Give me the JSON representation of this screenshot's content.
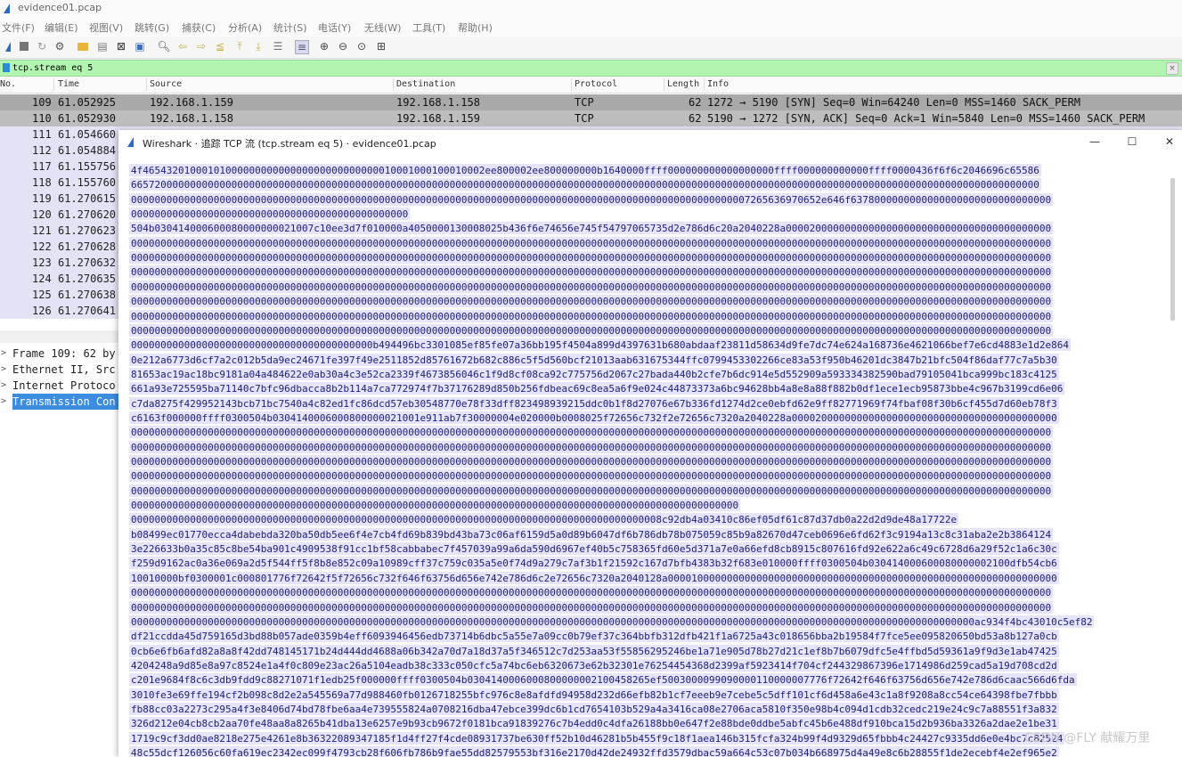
{
  "window": {
    "title": "evidence01.pcap"
  },
  "menu": [
    "文件(F)",
    "编辑(E)",
    "视图(V)",
    "跳转(G)",
    "捕获(C)",
    "分析(A)",
    "统计(S)",
    "电话(Y)",
    "无线(W)",
    "工具(T)",
    "帮助(H)"
  ],
  "toolbar_icons": [
    "shark-fin-start-icon",
    "stop-icon",
    "restart-icon",
    "capture-options-icon",
    "open-folder-icon",
    "save-icon",
    "close-file-icon",
    "reload-icon",
    "find-icon",
    "go-back-icon",
    "go-forward-icon",
    "go-to-packet-icon",
    "go-first-icon",
    "go-last-icon",
    "auto-scroll-icon",
    "colorize-icon",
    "zoom-in-icon",
    "zoom-out-icon",
    "zoom-reset-icon",
    "resize-columns-icon"
  ],
  "filter": {
    "value": "tcp.stream eq 5"
  },
  "packet_list": {
    "headers": {
      "no": "No.",
      "time": "Time",
      "source": "Source",
      "destination": "Destination",
      "protocol": "Protocol",
      "length": "Length",
      "info": "Info"
    },
    "rows": [
      {
        "no": "109",
        "time": "61.052925",
        "source": "192.168.1.159",
        "destination": "192.168.1.158",
        "protocol": "TCP",
        "length": "62",
        "info": "1272 → 5190 [SYN] Seq=0 Win=64240 Len=0 MSS=1460 SACK_PERM"
      },
      {
        "no": "110",
        "time": "61.052930",
        "source": "192.168.1.158",
        "destination": "192.168.1.159",
        "protocol": "TCP",
        "length": "62",
        "info": "5190 → 1272 [SYN, ACK] Seq=0 Ack=1 Win=5840 Len=0 MSS=1460 SACK_PERM"
      },
      {
        "no": "111",
        "time": "61.054660"
      },
      {
        "no": "112",
        "time": "61.054884"
      },
      {
        "no": "117",
        "time": "61.155756"
      },
      {
        "no": "118",
        "time": "61.155760"
      },
      {
        "no": "119",
        "time": "61.270615"
      },
      {
        "no": "120",
        "time": "61.270620"
      },
      {
        "no": "121",
        "time": "61.270623"
      },
      {
        "no": "122",
        "time": "61.270628"
      },
      {
        "no": "123",
        "time": "61.270632"
      },
      {
        "no": "124",
        "time": "61.270635"
      },
      {
        "no": "125",
        "time": "61.270638"
      },
      {
        "no": "126",
        "time": "61.270641"
      }
    ]
  },
  "details": [
    "Frame 109: 62 by",
    "Ethernet II, Src",
    "Internet Protoco",
    "Transmission Con"
  ],
  "dialog": {
    "title": "Wireshark · 追踪 TCP 流 (tcp.stream eq 5) · evidence01.pcap",
    "stream_lines": [
      "4f4654320100010100000000000000000000000000010001000100010002ee800002ee800000000b1640000ffff000000000000000000ffff000000000000ffff0000436f6f6c2046696c65586",
      "6657200000000000000000000000000000000000000000000000000000000000000000000000000000000000000000000000000000000000000000000000000000000000000000000000000000",
      "000000000000000000000000000000000000000000000000000000000000000000000000000000000000000000000000000000007265636970652e646f6378000000000000000000000000000000",
      "00000000000000000000000000000000000000000000000",
      "504b030414000600080000000021007c10ee3d7f010000a4050000130008025b436f6e74656e745f54797065735d2e786d6c20a2040228a000020000000000000000000000000000000000000000",
      "000000000000000000000000000000000000000000000000000000000000000000000000000000000000000000000000000000000000000000000000000000000000000000000000000000000000",
      "000000000000000000000000000000000000000000000000000000000000000000000000000000000000000000000000000000000000000000000000000000000000000000000000000000000000",
      "000000000000000000000000000000000000000000000000000000000000000000000000000000000000000000000000000000000000000000000000000000000000000000000000000000000000",
      "000000000000000000000000000000000000000000000000000000000000000000000000000000000000000000000000000000000000000000000000000000000000000000000000000000000000",
      "000000000000000000000000000000000000000000000000000000000000000000000000000000000000000000000000000000000000000000000000000000000000000000000000000000000000",
      "000000000000000000000000000000000000000000000000000000000000000000000000000000000000000000000000000000000000000000000000000000000000000000000000000000000000",
      "000000000000000000000000000000000000000000000000000000000000000000000000000000000000000000000000000000000000000000000000000000000000000000000000000000000000",
      "00000000000000000000000000000000000000000b494496bc3301085ef85fe07a36bb195f4504a899d4397631b680abdaaf23811d58634d9fe7dc74e624a168736e4621066bef7e6cd4883e1d2e864",
      "0e212a6773d6cf7a2c012b5da9ec24671fe397f49e2511852d85761672b682c886c5f5d560bcf21013aab631675344ffc0799453302266ce83a53f950b46201dc3847b21bfc504f86daf77c7a5b30",
      "81653ac19ac18bc9181a04a484622e0ab30a4c3e52ca2339f4673856046c1f9d8cf08ca92c775756d2067c27bada440b2cfe7b6dc914e5d552909a593334382590bad79105041bca999bc183c4125",
      "661a93e725595ba71140c7bfc96dbacca8b2b114a7ca772974f7b37176289d850b256fdbeac69c8ea5a6f9e024c44873373a6bc94628bb4a8e8a88f882b0df1ece1ecb95873bbe4c967b3199cd6e06",
      "c7da8275f429952143bcb71bc7540a4c82ed1fc86dcd57eb30548770e78f33dff823498939215ddc0b1f8d27076e67b336fd1274d2ce0ebfd62e9ff82771969f74fbaf08f30b6cf455d7d60eb78f3",
      "c6163f000000ffff0300504b0304140006000800000021001e911ab7f30000004e020000b0008025f72656c732f2e72656c7320a2040228a000020000000000000000000000000000000000000000",
      "000000000000000000000000000000000000000000000000000000000000000000000000000000000000000000000000000000000000000000000000000000000000000000000000000000000000",
      "000000000000000000000000000000000000000000000000000000000000000000000000000000000000000000000000000000000000000000000000000000000000000000000000000000000000",
      "000000000000000000000000000000000000000000000000000000000000000000000000000000000000000000000000000000000000000000000000000000000000000000000000000000000000",
      "000000000000000000000000000000000000000000000000000000000000000000000000000000000000000000000000000000000000000000000000000000000000000000000000000000000000",
      "000000000000000000000000000000000000000000000000000000000000000000000000000000000000000000000000000000000000000000000000000000000000000000000000000000000000",
      "0000000000000000000000000000000000000000000000000000000000000000000000000000000000000000000000000000000",
      "000000000000000000000000000000000000000000000000000000000000000000000000000000000000000008c92db4a03410c86ef05df61c87d37db0a22d2d9de48a17722e",
      "b08499ec01770ecca4dabebda320ba50db5ee6f4e7cb4fd69b839bd43ba73c06af6159d5a0d89b6047df6b786db78b075059c85b9a82670d47ceb0696e6fd62f3c9194a13c8c31aba2e2b3864124",
      "3e226633b0a35c85c8be54ba901c4909538f91cc1bf58cabbabec7f457039a99a6da590d6967ef40b5c758365fd60e5d371a7e0a66efd8cb8915c807616fd92e622a6c49c6728d6a29f52c1a6c30c",
      "f259d9162ac0a36e069a2d5f544ff5f8b8e852c09a10989cff37c759c035a5e0f74d9a279c7af3b1f21592c167d7bfb4383b32f683e010000ffff0300504b030414000600080000002100dfb54cb6",
      "10010000bf0300001c000801776f72642f5f72656c732f646f63756d656e742e786d6c2e72656c7320a2040128a000010000000000000000000000000000000000000000000000000000000000000",
      "000000000000000000000000000000000000000000000000000000000000000000000000000000000000000000000000000000000000000000000000000000000000000000000000000000000000",
      "000000000000000000000000000000000000000000000000000000000000000000000000000000000000000000000000000000000000000000000000000000000000000000000000000000000000",
      "00000000000000000000000000000000000000000000000000000000000000000000000000000000000000000000000000000000000000000000000000000000000000000000000ac934f4bc43010c5ef82",
      "df21ccdda45d759165d3bd88b057ade0359b4eff6093946456edb73714b6dbc5a55e7a09cc0b79ef37c364bbfb312dfb421f1a6725a43c018656bba2b19584f7fce5ee095820650bd53a8b127a0cb",
      "0cb6e6fb6afd82a8a8f42dd748145171b24d444dd4688a06b342a70d7a18d37a5f346512c7d253aa53f55856295246be1a71e905d78b27d21c1ef8b7b6079dfc5e4ffbd5d59361a9f9d3e1ab47425",
      "4204248a9d85e8a97c8524e1a4f0c809e23ac26a5104eadb38c333c050cfc5a74bc6eb6320673e62b32301e76254454368d2399af5923414f704cf244329867396e1714986d259cad5a19d708cd2d",
      "c201e9684f8c6c3db9fdd9c88271071f1edb25f000000ffff0300504b0304140006000800000002100458265ef5003000099090000110000007776f72642f646f63756d656e742e786d6caac566d6fda",
      "3010fe3e69ffe194cf2b098c8d2e2a545569a77d988460fb0126718255bfc976c8e8afdfd94958d232d66efb82b1cf7eeeb9e7cebe5c5dff101cf6d458a6e43c1a8f9208a8cc54ce64398fbe7fbbb",
      "fb88cc03a2273c295a4f3e8406d74bd78fbe6aa4e739555824a0708216dba47ebce399dc6b1cd7654103b529a4a3416ca08e2706aca5810f350e98b4c094d1cdb32cedc219e24c9c7a88551f3a832",
      "326d212e04cb8cb2aa70fe48aa8a8265b41dba13e6257e9b93cb9672f0181bca91839276c7b4edd0c4dfa26188bb0e647f2e88bde0ddbe5abfc45b6e488df910bca15d2b936ba3326a2dae2e1be31",
      "1719c9cf3dd0ae8218e275e4261e8b36322089347185f1d4ff27f4cde08931737be630ff52b10d46281b5b455f9c18f1aea146b315fcfa324b99f4d9329d65fbbb4c24427c9335dd6e0e4bc7c82524",
      "48c55dcf126056c60fa619ec2342ec099f4793cb28f606fb786b9fae55dd82579553bf316e2170d42de24932ffd3579dbac59a664c53c07b034b668975d4a49e8c6b28855f1de2ecebf4e2ef965e2"
    ]
  },
  "watermark": "CSDN @FLY 献耀万里"
}
